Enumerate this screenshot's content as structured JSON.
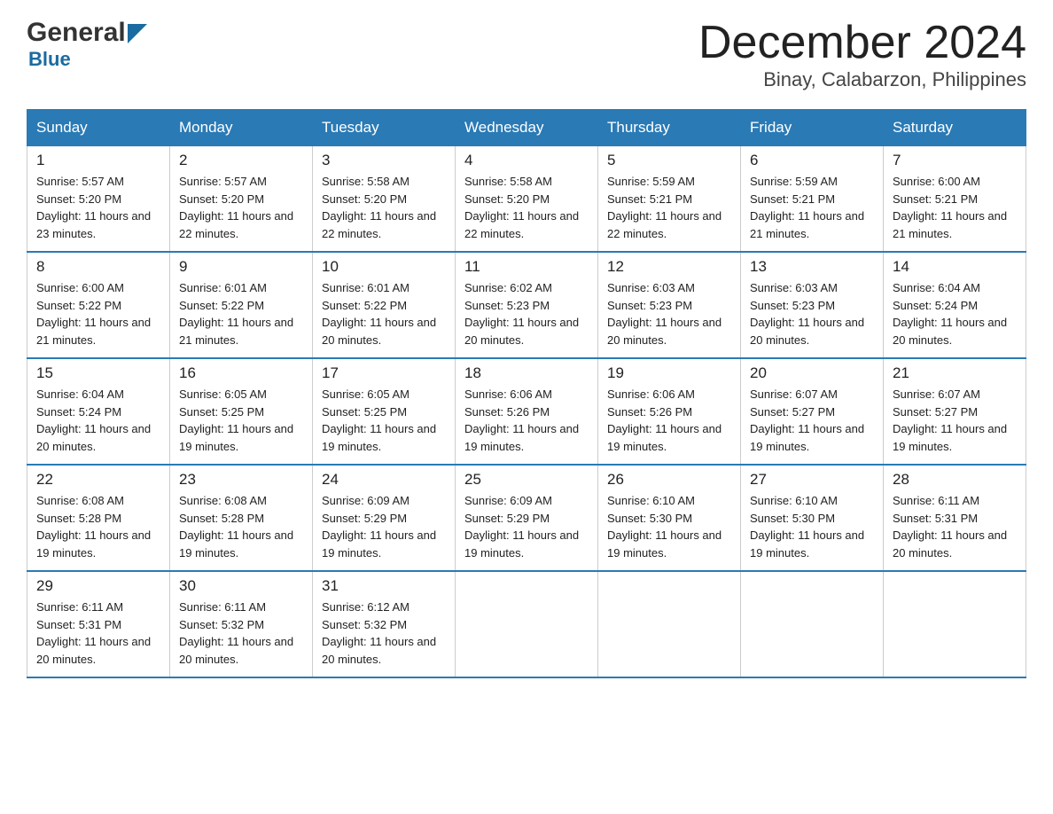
{
  "header": {
    "title": "December 2024",
    "subtitle": "Binay, Calabarzon, Philippines",
    "logo_general": "General",
    "logo_blue": "Blue"
  },
  "weekdays": [
    "Sunday",
    "Monday",
    "Tuesday",
    "Wednesday",
    "Thursday",
    "Friday",
    "Saturday"
  ],
  "weeks": [
    [
      {
        "day": "1",
        "sunrise": "5:57 AM",
        "sunset": "5:20 PM",
        "daylight": "11 hours and 23 minutes."
      },
      {
        "day": "2",
        "sunrise": "5:57 AM",
        "sunset": "5:20 PM",
        "daylight": "11 hours and 22 minutes."
      },
      {
        "day": "3",
        "sunrise": "5:58 AM",
        "sunset": "5:20 PM",
        "daylight": "11 hours and 22 minutes."
      },
      {
        "day": "4",
        "sunrise": "5:58 AM",
        "sunset": "5:20 PM",
        "daylight": "11 hours and 22 minutes."
      },
      {
        "day": "5",
        "sunrise": "5:59 AM",
        "sunset": "5:21 PM",
        "daylight": "11 hours and 22 minutes."
      },
      {
        "day": "6",
        "sunrise": "5:59 AM",
        "sunset": "5:21 PM",
        "daylight": "11 hours and 21 minutes."
      },
      {
        "day": "7",
        "sunrise": "6:00 AM",
        "sunset": "5:21 PM",
        "daylight": "11 hours and 21 minutes."
      }
    ],
    [
      {
        "day": "8",
        "sunrise": "6:00 AM",
        "sunset": "5:22 PM",
        "daylight": "11 hours and 21 minutes."
      },
      {
        "day": "9",
        "sunrise": "6:01 AM",
        "sunset": "5:22 PM",
        "daylight": "11 hours and 21 minutes."
      },
      {
        "day": "10",
        "sunrise": "6:01 AM",
        "sunset": "5:22 PM",
        "daylight": "11 hours and 20 minutes."
      },
      {
        "day": "11",
        "sunrise": "6:02 AM",
        "sunset": "5:23 PM",
        "daylight": "11 hours and 20 minutes."
      },
      {
        "day": "12",
        "sunrise": "6:03 AM",
        "sunset": "5:23 PM",
        "daylight": "11 hours and 20 minutes."
      },
      {
        "day": "13",
        "sunrise": "6:03 AM",
        "sunset": "5:23 PM",
        "daylight": "11 hours and 20 minutes."
      },
      {
        "day": "14",
        "sunrise": "6:04 AM",
        "sunset": "5:24 PM",
        "daylight": "11 hours and 20 minutes."
      }
    ],
    [
      {
        "day": "15",
        "sunrise": "6:04 AM",
        "sunset": "5:24 PM",
        "daylight": "11 hours and 20 minutes."
      },
      {
        "day": "16",
        "sunrise": "6:05 AM",
        "sunset": "5:25 PM",
        "daylight": "11 hours and 19 minutes."
      },
      {
        "day": "17",
        "sunrise": "6:05 AM",
        "sunset": "5:25 PM",
        "daylight": "11 hours and 19 minutes."
      },
      {
        "day": "18",
        "sunrise": "6:06 AM",
        "sunset": "5:26 PM",
        "daylight": "11 hours and 19 minutes."
      },
      {
        "day": "19",
        "sunrise": "6:06 AM",
        "sunset": "5:26 PM",
        "daylight": "11 hours and 19 minutes."
      },
      {
        "day": "20",
        "sunrise": "6:07 AM",
        "sunset": "5:27 PM",
        "daylight": "11 hours and 19 minutes."
      },
      {
        "day": "21",
        "sunrise": "6:07 AM",
        "sunset": "5:27 PM",
        "daylight": "11 hours and 19 minutes."
      }
    ],
    [
      {
        "day": "22",
        "sunrise": "6:08 AM",
        "sunset": "5:28 PM",
        "daylight": "11 hours and 19 minutes."
      },
      {
        "day": "23",
        "sunrise": "6:08 AM",
        "sunset": "5:28 PM",
        "daylight": "11 hours and 19 minutes."
      },
      {
        "day": "24",
        "sunrise": "6:09 AM",
        "sunset": "5:29 PM",
        "daylight": "11 hours and 19 minutes."
      },
      {
        "day": "25",
        "sunrise": "6:09 AM",
        "sunset": "5:29 PM",
        "daylight": "11 hours and 19 minutes."
      },
      {
        "day": "26",
        "sunrise": "6:10 AM",
        "sunset": "5:30 PM",
        "daylight": "11 hours and 19 minutes."
      },
      {
        "day": "27",
        "sunrise": "6:10 AM",
        "sunset": "5:30 PM",
        "daylight": "11 hours and 19 minutes."
      },
      {
        "day": "28",
        "sunrise": "6:11 AM",
        "sunset": "5:31 PM",
        "daylight": "11 hours and 20 minutes."
      }
    ],
    [
      {
        "day": "29",
        "sunrise": "6:11 AM",
        "sunset": "5:31 PM",
        "daylight": "11 hours and 20 minutes."
      },
      {
        "day": "30",
        "sunrise": "6:11 AM",
        "sunset": "5:32 PM",
        "daylight": "11 hours and 20 minutes."
      },
      {
        "day": "31",
        "sunrise": "6:12 AM",
        "sunset": "5:32 PM",
        "daylight": "11 hours and 20 minutes."
      },
      null,
      null,
      null,
      null
    ]
  ]
}
